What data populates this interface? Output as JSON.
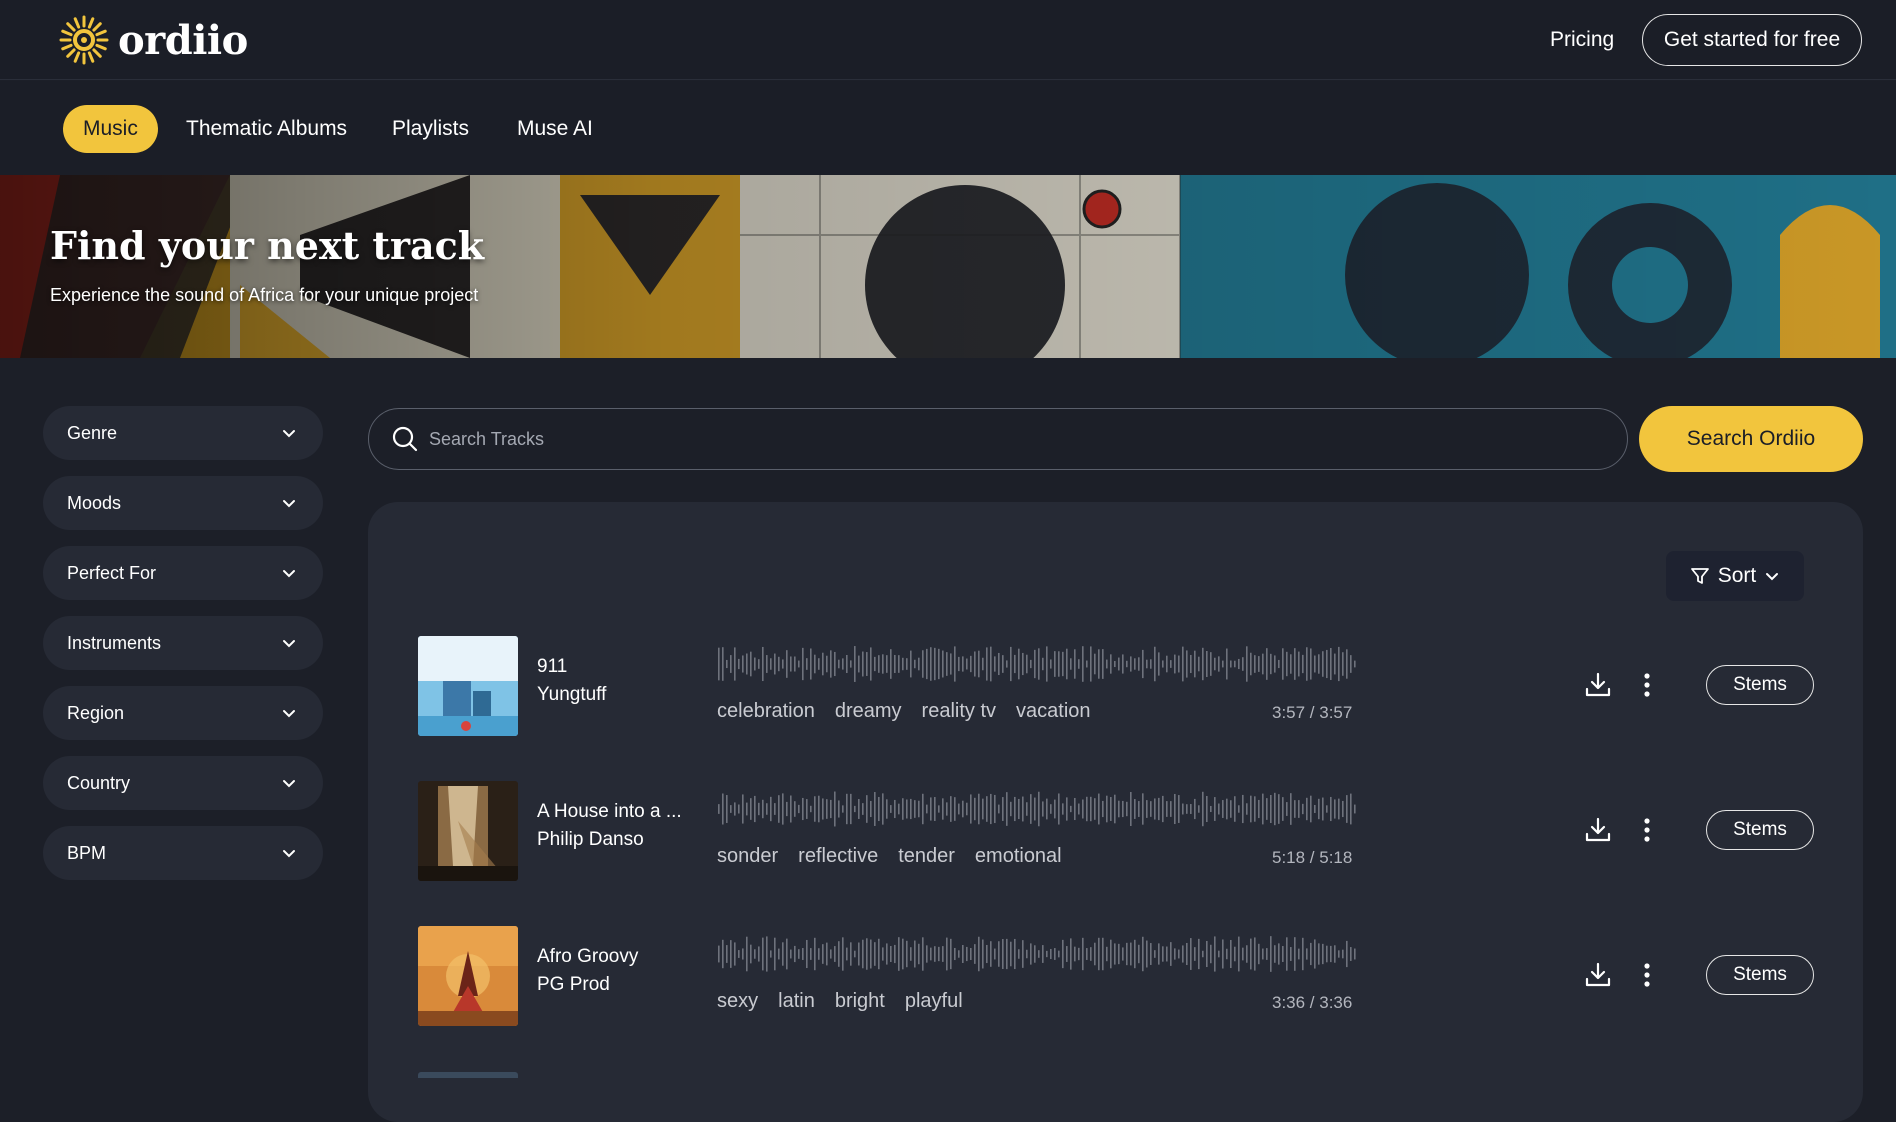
{
  "header": {
    "logo_text": "ordiio",
    "pricing_label": "Pricing",
    "cta_label": "Get started for free"
  },
  "nav": {
    "tabs": [
      {
        "label": "Music",
        "active": true
      },
      {
        "label": "Thematic Albums",
        "active": false
      },
      {
        "label": "Playlists",
        "active": false
      },
      {
        "label": "Muse AI",
        "active": false
      }
    ]
  },
  "hero": {
    "title": "Find your next track",
    "subtitle": "Experience the sound of Africa for your unique project"
  },
  "filters": [
    {
      "label": "Genre"
    },
    {
      "label": "Moods"
    },
    {
      "label": "Perfect For"
    },
    {
      "label": "Instruments"
    },
    {
      "label": "Region"
    },
    {
      "label": "Country"
    },
    {
      "label": "BPM"
    }
  ],
  "search": {
    "placeholder": "Search Tracks",
    "value": "",
    "button_label": "Search Ordiio"
  },
  "sort": {
    "label": "Sort"
  },
  "tracks": [
    {
      "title": "911",
      "artist": "Yungtuff",
      "tags": [
        "celebration",
        "dreamy",
        "reality tv",
        "vacation"
      ],
      "time": "3:57 / 3:57",
      "stems_label": "Stems"
    },
    {
      "title": "A House into a ...",
      "artist": "Philip Danso",
      "tags": [
        "sonder",
        "reflective",
        "tender",
        "emotional"
      ],
      "time": "5:18 / 5:18",
      "stems_label": "Stems"
    },
    {
      "title": "Afro Groovy",
      "artist": "PG Prod",
      "tags": [
        "sexy",
        "latin",
        "bright",
        "playful"
      ],
      "time": "3:36 / 3:36",
      "stems_label": "Stems"
    }
  ],
  "colors": {
    "accent": "#f2c53d",
    "background": "#1c1f28",
    "panel": "#262a35"
  }
}
